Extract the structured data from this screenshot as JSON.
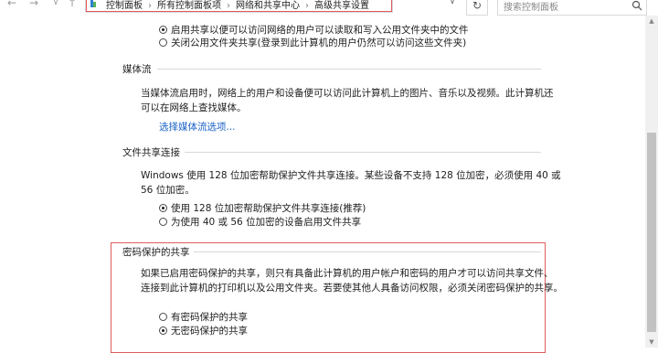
{
  "address_bar": {
    "breadcrumb": [
      "控制面板",
      "所有控制面板项",
      "网络和共享中心",
      "高级共享设置"
    ],
    "search_placeholder": "搜索控制面板"
  },
  "public_folder": {
    "options": [
      {
        "label": "启用共享以便可以访问网络的用户可以读取和写入公用文件夹中的文件",
        "checked": true
      },
      {
        "label": "关闭公用文件夹共享(登录到此计算机的用户仍然可以访问这些文件夹)",
        "checked": false
      }
    ]
  },
  "media_streaming": {
    "title": "媒体流",
    "description_line1": "当媒体流启用时，网络上的用户和设备便可以访问此计算机上的图片、音乐以及视频。此计算机还",
    "description_line2": "可以在网络上查找媒体。",
    "link": "选择媒体流选项..."
  },
  "file_sharing_connections": {
    "title": "文件共享连接",
    "description_line1": "Windows 使用 128 位加密帮助保护文件共享连接。某些设备不支持 128 位加密，必须使用 40 或",
    "description_line2": "56 位加密。",
    "options": [
      {
        "label": "使用 128 位加密帮助保护文件共享连接(推荐)",
        "checked": true
      },
      {
        "label": "为使用 40 或 56 位加密的设备启用文件共享",
        "checked": false
      }
    ]
  },
  "password_protected_sharing": {
    "title": "密码保护的共享",
    "description_line1": "如果已启用密码保护的共享，则只有具备此计算机的用户帐户和密码的用户才可以访问共享文件、",
    "description_line2": "连接到此计算机的打印机以及公用文件夹。若要使其他人具备访问权限，必须关闭密码保护的共享。",
    "options": [
      {
        "label": "有密码保护的共享",
        "checked": false
      },
      {
        "label": "无密码保护的共享",
        "checked": true
      }
    ]
  },
  "colors": {
    "link": "#1a62c6",
    "highlight_box": "#e05d5d"
  }
}
